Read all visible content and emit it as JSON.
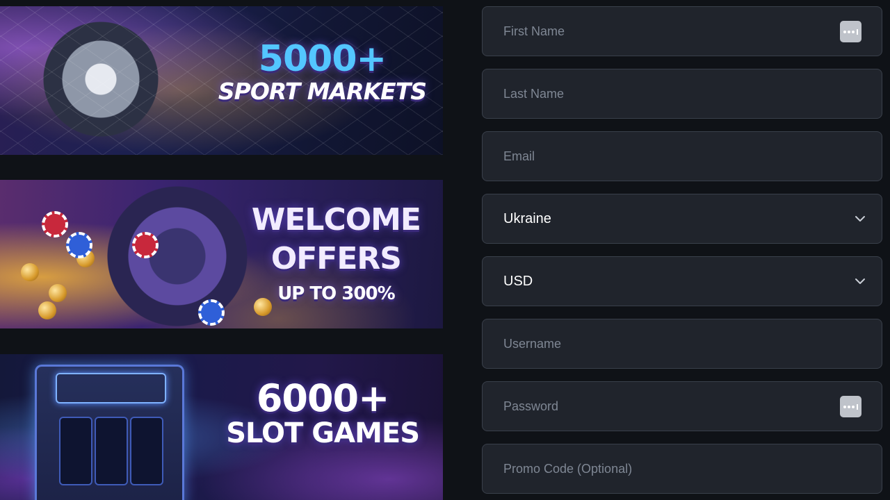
{
  "banners": [
    {
      "line1": "5000+",
      "line2": "SPORT MARKETS"
    },
    {
      "line1": "WELCOME",
      "line2": "OFFERS",
      "line3": "UP TO 300%"
    },
    {
      "line1": "6000+",
      "line2": "SLOT GAMES"
    }
  ],
  "form": {
    "first_name": {
      "placeholder": "First Name",
      "value": ""
    },
    "last_name": {
      "placeholder": "Last Name",
      "value": ""
    },
    "email": {
      "placeholder": "Email",
      "value": ""
    },
    "country": {
      "value": "Ukraine"
    },
    "currency": {
      "value": "USD"
    },
    "username": {
      "placeholder": "Username",
      "value": ""
    },
    "password": {
      "placeholder": "Password",
      "value": ""
    },
    "promo_code": {
      "placeholder": "Promo Code (Optional)",
      "value": ""
    }
  },
  "icons": {
    "autofill": "password-manager-key-icon",
    "dropdown": "chevron-down-icon"
  },
  "colors": {
    "page_bg": "#0f1217",
    "field_bg": "#20242c",
    "field_border": "#3a404b",
    "placeholder": "#7f8794",
    "value_text": "#ffffff"
  }
}
